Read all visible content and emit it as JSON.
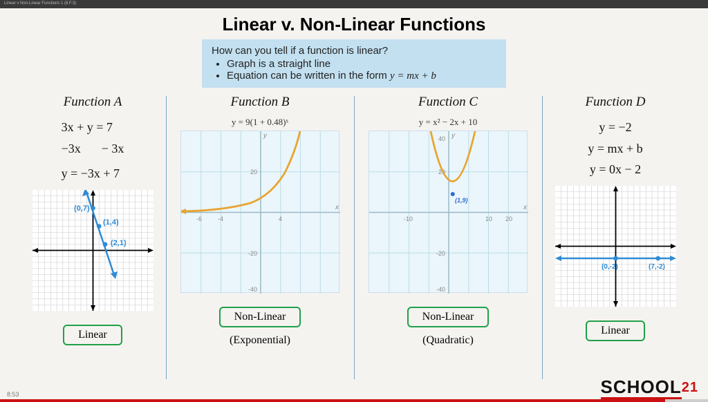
{
  "window_title": "Linear v Non-Linear Functions 1 (8.F.3)",
  "title": "Linear v. Non-Linear Functions",
  "info": {
    "question": "How can you tell if a function is linear?",
    "bullet1": "Graph is a straight line",
    "bullet2_prefix": "Equation can be written in the form ",
    "bullet2_eq": "y = mx + b"
  },
  "functions": {
    "A": {
      "title": "Function A",
      "eq1": "3x + y = 7",
      "eq2a": "−3x",
      "eq2b": "− 3x",
      "eq3": "y = −3x + 7",
      "points": {
        "p1": "(0,7)",
        "p2": "(1,4)",
        "p3": "(2,1)"
      },
      "badge": "Linear"
    },
    "B": {
      "title": "Function B",
      "eq": "y =  9(1 + 0.48)ˣ",
      "badge": "Non-Linear",
      "subtype": "(Exponential)"
    },
    "C": {
      "title": "Function C",
      "eq": "y =  x² − 2x + 10",
      "vertex": "(1,9)",
      "badge": "Non-Linear",
      "subtype": "(Quadratic)"
    },
    "D": {
      "title": "Function D",
      "eq1": "y = −2",
      "eq2": "y = mx + b",
      "eq3": "y = 0x − 2",
      "points": {
        "p1": "(0,-2)",
        "p2": "(7,-2)"
      },
      "badge": "Linear"
    }
  },
  "logo": {
    "text": "SCHOOL",
    "suffix": "21"
  },
  "timecode": "8:53",
  "chart_data": [
    {
      "type": "line",
      "name": "Function A",
      "title": "y = -3x + 7",
      "x": [
        0,
        1,
        2
      ],
      "y": [
        7,
        4,
        1
      ],
      "xlabel": "",
      "ylabel": "",
      "xlim": [
        -10,
        10
      ],
      "ylim": [
        -10,
        10
      ]
    },
    {
      "type": "line",
      "name": "Function B",
      "title": "y = 9(1+0.48)^x",
      "x": [
        -8,
        -4,
        0,
        2,
        4,
        5
      ],
      "y": [
        0.4,
        1.9,
        9,
        19.7,
        43.2,
        64
      ],
      "xlabel": "",
      "ylabel": "",
      "xlim": [
        -8,
        8
      ],
      "ylim": [
        -40,
        40
      ]
    },
    {
      "type": "line",
      "name": "Function C",
      "title": "y = x^2 - 2x + 10",
      "x": [
        -5,
        -2,
        0,
        1,
        2,
        4,
        7
      ],
      "y": [
        45,
        18,
        10,
        9,
        10,
        18,
        45
      ],
      "xlabel": "",
      "ylabel": "",
      "xlim": [
        -20,
        20
      ],
      "ylim": [
        -40,
        40
      ],
      "vertex": [
        1,
        9
      ]
    },
    {
      "type": "line",
      "name": "Function D",
      "title": "y = -2",
      "x": [
        0,
        7
      ],
      "y": [
        -2,
        -2
      ],
      "xlabel": "",
      "ylabel": "",
      "xlim": [
        -10,
        10
      ],
      "ylim": [
        -10,
        10
      ]
    }
  ]
}
